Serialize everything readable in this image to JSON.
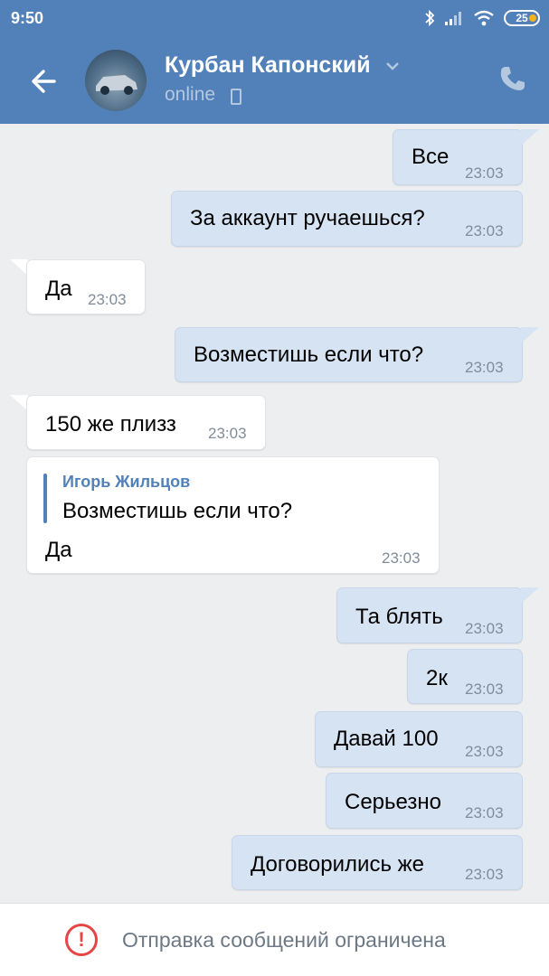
{
  "status_bar": {
    "time": "9:50",
    "battery": "25"
  },
  "header": {
    "contact_name": "Курбан Капонский",
    "status": "online"
  },
  "messages": [
    {
      "text": "Все",
      "time": "23:03",
      "direction": "out"
    },
    {
      "text": "За аккаунт ручаешься?",
      "time": "23:03",
      "direction": "out"
    },
    {
      "text": "Да",
      "time": "23:03",
      "direction": "in"
    },
    {
      "text": "Возместишь если что?",
      "time": "23:03",
      "direction": "out"
    },
    {
      "text": "150 же плизз",
      "time": "23:03",
      "direction": "in"
    },
    {
      "reply_sender": "Игорь Жильцов",
      "reply_text": "Возместишь если что?",
      "text": "Да",
      "time": "23:03",
      "direction": "in"
    },
    {
      "text": "Та блять",
      "time": "23:03",
      "direction": "out"
    },
    {
      "text": "2к",
      "time": "23:03",
      "direction": "out"
    },
    {
      "text": "Давай 100",
      "time": "23:03",
      "direction": "out"
    },
    {
      "text": "Серьезно",
      "time": "23:03",
      "direction": "out"
    },
    {
      "text": "Договорились же",
      "time": "23:03",
      "direction": "out"
    }
  ],
  "footer": {
    "warning_text": "Отправка сообщений ограничена",
    "warning_symbol": "!"
  },
  "colors": {
    "header": "#5181b8",
    "outgoing_bubble": "#d6e3f3",
    "incoming_bubble": "#ffffff",
    "warning": "#e64646"
  }
}
